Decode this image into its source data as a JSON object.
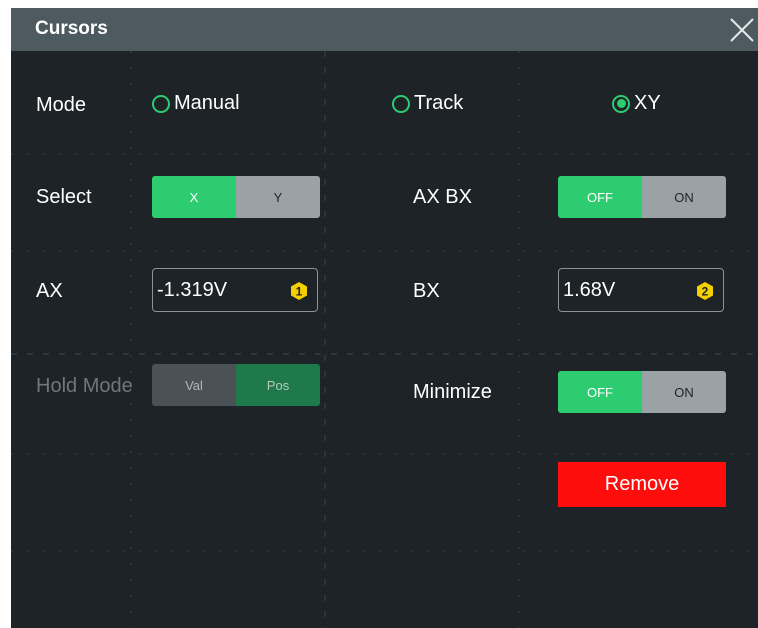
{
  "dialog": {
    "title": "Cursors",
    "close_icon": "close-x-icon"
  },
  "mode": {
    "label": "Mode",
    "options": [
      "Manual",
      "Track",
      "XY"
    ],
    "selected": "XY"
  },
  "select": {
    "label": "Select",
    "options": [
      "X",
      "Y"
    ],
    "selected": "X"
  },
  "ax_bx": {
    "label": "AX BX",
    "options": [
      "OFF",
      "ON"
    ],
    "selected": "OFF"
  },
  "ax": {
    "label": "AX",
    "value": "-1.319V",
    "badge": "1"
  },
  "bx": {
    "label": "BX",
    "value": "1.68V",
    "badge": "2"
  },
  "hold_mode": {
    "label": "Hold Mode",
    "options": [
      "Val",
      "Pos"
    ],
    "selected": "Pos",
    "enabled": false
  },
  "minimize": {
    "label": "Minimize",
    "options": [
      "OFF",
      "ON"
    ],
    "selected": "OFF"
  },
  "remove_label": "Remove",
  "colors": {
    "accent": "#2ecc71",
    "danger": "#ff0d0d",
    "title_bar": "#4d5a60",
    "background": "#1d2327",
    "badge": "#f5d000"
  }
}
